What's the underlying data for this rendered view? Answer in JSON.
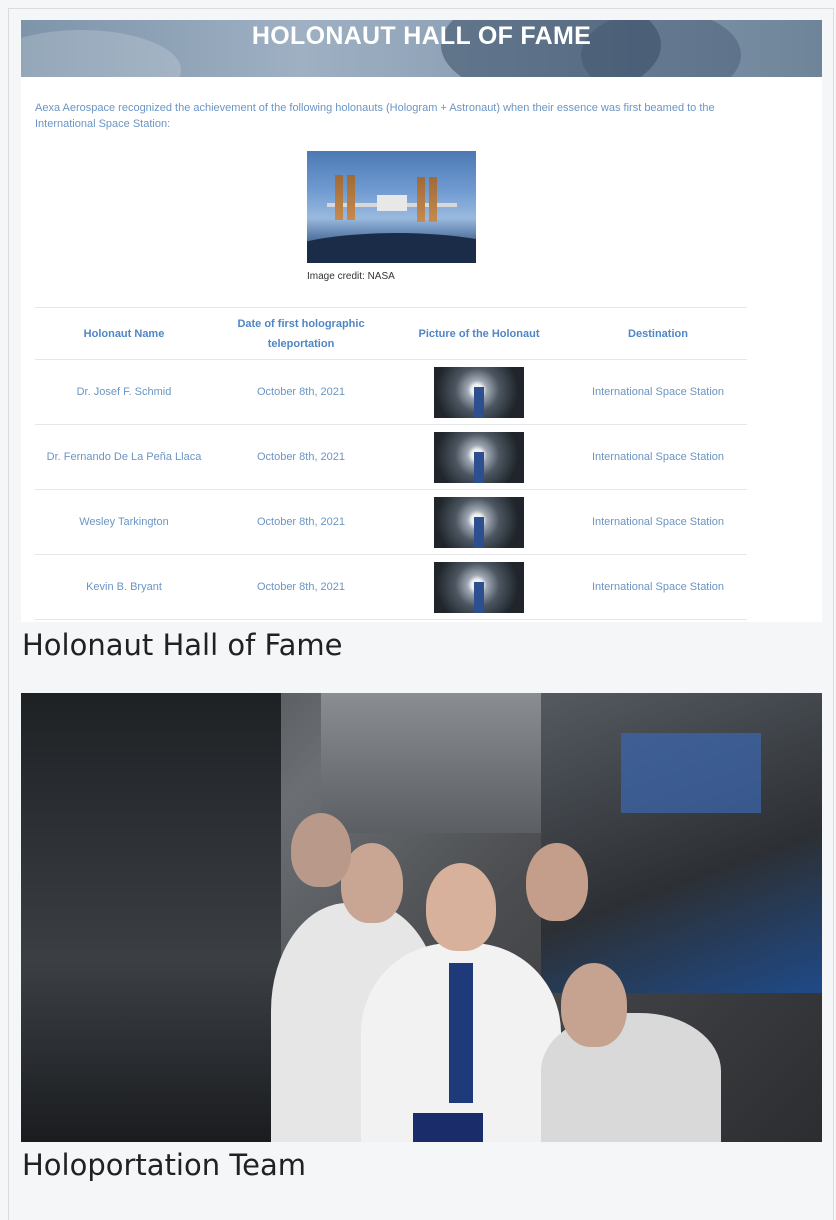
{
  "web_panel": {
    "banner_title": "HOLONAUT HALL OF FAME",
    "intro": "Aexa Aerospace recognized the achievement of the following holonauts (Hologram + Astronaut) when their essence was first beamed to the International Space Station:",
    "image_credit": "Image credit: NASA",
    "table": {
      "headers": [
        "Holonaut Name",
        "Date of first holographic teleportation",
        "Picture of the Holonaut",
        "Destination"
      ],
      "rows": [
        {
          "name": "Dr. Josef F. Schmid",
          "date": "October 8th, 2021",
          "destination": "International Space Station"
        },
        {
          "name": "Dr. Fernando De La Peña Llaca",
          "date": "October 8th, 2021",
          "destination": "International Space Station"
        },
        {
          "name": "Wesley Tarkington",
          "date": "October 8th, 2021",
          "destination": "International Space Station"
        },
        {
          "name": "Kevin B. Bryant",
          "date": "October 8th, 2021",
          "destination": "International Space Station"
        }
      ]
    }
  },
  "captions": {
    "first": "Holonaut Hall of Fame",
    "second": "Holoportation Team"
  }
}
